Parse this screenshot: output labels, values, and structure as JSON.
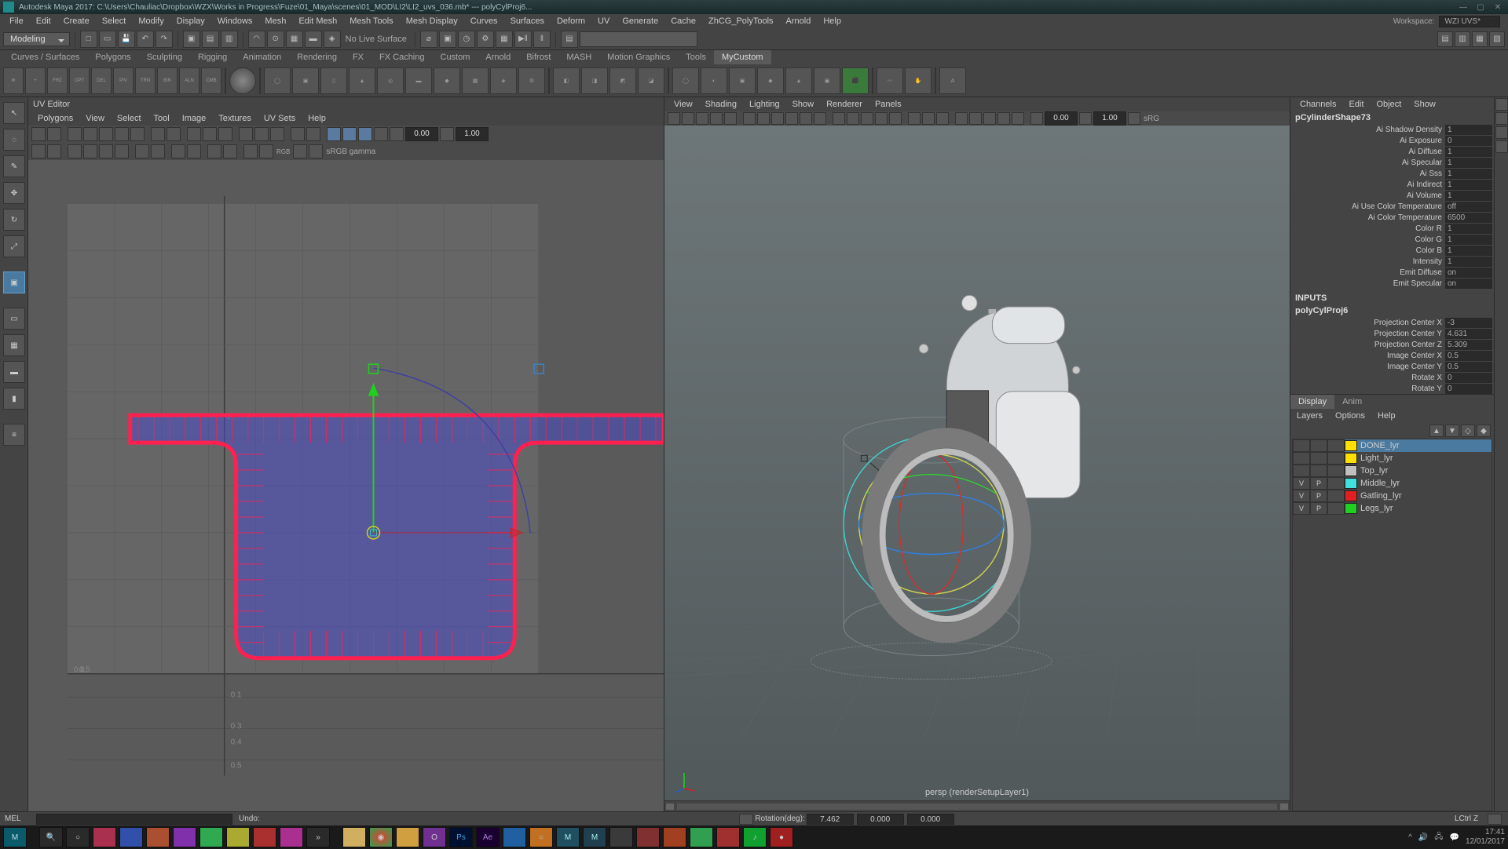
{
  "title": "Autodesk Maya 2017: C:\\Users\\Chauliac\\Dropbox\\WZX\\Works in Progress\\Fuze\\01_Maya\\scenes\\01_MOD\\LI2\\LI2_uvs_036.mb*  ---  polyCylProj6...",
  "workspace_label": "Workspace:",
  "workspace_value": "WZI UVS*",
  "main_menu": [
    "File",
    "Edit",
    "Create",
    "Select",
    "Modify",
    "Display",
    "Windows",
    "Mesh",
    "Edit Mesh",
    "Mesh Tools",
    "Mesh Display",
    "Curves",
    "Surfaces",
    "Deform",
    "UV",
    "Generate",
    "Cache",
    "ZhCG_PolyTools",
    "Arnold",
    "Help"
  ],
  "mode": "Modeling",
  "no_live_surface": "No Live Surface",
  "shelf_tabs": [
    "Curves / Surfaces",
    "Polygons",
    "Sculpting",
    "Rigging",
    "Animation",
    "Rendering",
    "FX",
    "FX Caching",
    "Custom",
    "Arnold",
    "Bifrost",
    "MASH",
    "Motion Graphics",
    "Tools",
    "MyCustom"
  ],
  "uv_editor": {
    "title": "UV Editor",
    "menu": [
      "Polygons",
      "View",
      "Select",
      "Tool",
      "Image",
      "Textures",
      "UV Sets",
      "Help"
    ],
    "num_a": "0.00",
    "num_b": "1.00",
    "gamma": "sRGB gamma"
  },
  "viewport": {
    "menu": [
      "View",
      "Shading",
      "Lighting",
      "Show",
      "Renderer",
      "Panels"
    ],
    "num_a": "0.00",
    "num_b": "1.00",
    "colorspace": "sRG",
    "camera_label": "persp (renderSetupLayer1)"
  },
  "channel_box": {
    "menu": [
      "Channels",
      "Edit",
      "Object",
      "Show"
    ],
    "shape_name": "pCylinderShape73",
    "attrs": [
      {
        "l": "Ai Shadow Density",
        "v": "1"
      },
      {
        "l": "Ai Exposure",
        "v": "0"
      },
      {
        "l": "Ai Diffuse",
        "v": "1"
      },
      {
        "l": "Ai Specular",
        "v": "1"
      },
      {
        "l": "Ai Sss",
        "v": "1"
      },
      {
        "l": "Ai Indirect",
        "v": "1"
      },
      {
        "l": "Ai Volume",
        "v": "1"
      },
      {
        "l": "Ai Use Color Temperature",
        "v": "off"
      },
      {
        "l": "Ai Color Temperature",
        "v": "6500"
      },
      {
        "l": "Color R",
        "v": "1"
      },
      {
        "l": "Color G",
        "v": "1"
      },
      {
        "l": "Color B",
        "v": "1"
      },
      {
        "l": "Intensity",
        "v": "1"
      },
      {
        "l": "Emit Diffuse",
        "v": "on"
      },
      {
        "l": "Emit Specular",
        "v": "on"
      }
    ],
    "inputs_label": "INPUTS",
    "input_node": "polyCylProj6",
    "input_attrs": [
      {
        "l": "Projection Center X",
        "v": "-3"
      },
      {
        "l": "Projection Center Y",
        "v": "4.631"
      },
      {
        "l": "Projection Center Z",
        "v": "5.309"
      },
      {
        "l": "Image Center X",
        "v": "0.5"
      },
      {
        "l": "Image Center Y",
        "v": "0.5"
      },
      {
        "l": "Rotate X",
        "v": "0"
      },
      {
        "l": "Rotate Y",
        "v": "0"
      }
    ]
  },
  "layers": {
    "tabs": [
      "Display",
      "Anim"
    ],
    "menu": [
      "Layers",
      "Options",
      "Help"
    ],
    "rows": [
      {
        "v": "",
        "p": "",
        "c": "#ffe000",
        "name": "DONE_lyr",
        "sel": true
      },
      {
        "v": "",
        "p": "",
        "c": "#ffe000",
        "name": "Light_lyr",
        "sel": false
      },
      {
        "v": "",
        "p": "",
        "c": "#c0c0c0",
        "name": "Top_lyr",
        "sel": false
      },
      {
        "v": "V",
        "p": "P",
        "c": "#40e0e0",
        "name": "Middle_lyr",
        "sel": false
      },
      {
        "v": "V",
        "p": "P",
        "c": "#e02020",
        "name": "Gatling_lyr",
        "sel": false
      },
      {
        "v": "V",
        "p": "P",
        "c": "#20d020",
        "name": "Legs_lyr",
        "sel": false
      }
    ]
  },
  "status": {
    "mel": "MEL",
    "msg": "Undo:",
    "center_label": "Rotation(deg):",
    "v1": "7.462",
    "v2": "0.000",
    "v3": "0.000",
    "hotkey": "LCtrl Z"
  },
  "taskbar": {
    "time": "17:41",
    "date": "12/01/2017"
  }
}
